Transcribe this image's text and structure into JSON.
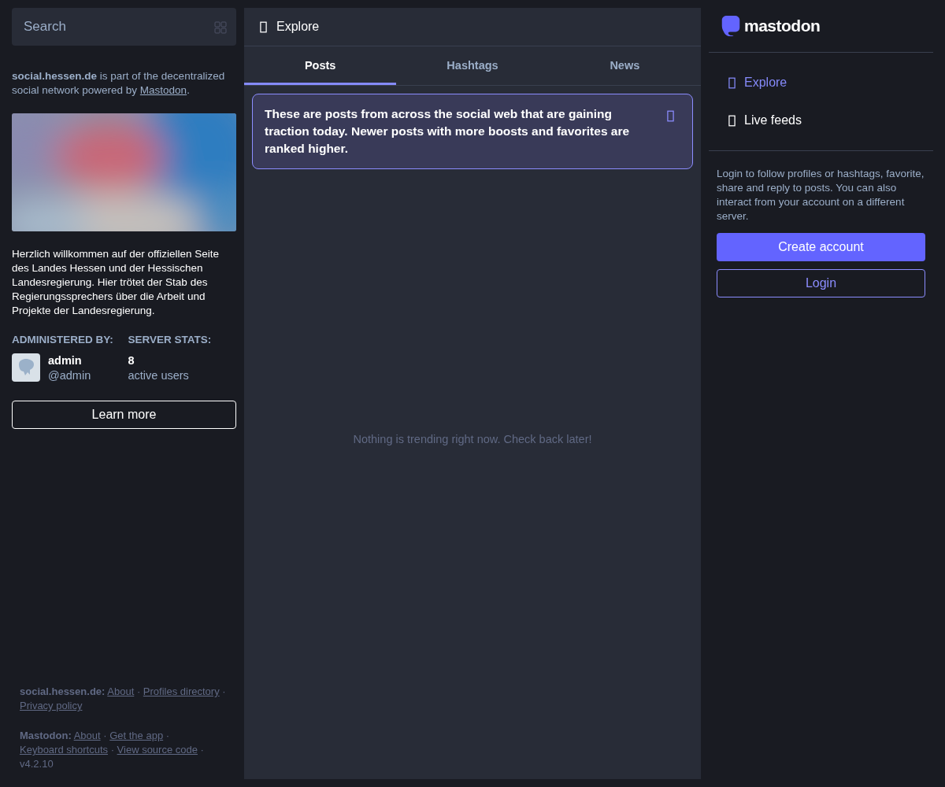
{
  "search": {
    "placeholder": "Search"
  },
  "intro": {
    "domain": "social.hessen.de",
    "text": " is part of the decentralized social network powered by ",
    "link": "Mastodon",
    "after": "."
  },
  "description": "Herzlich willkommen auf der offiziellen Seite des Landes Hessen und der Hessischen Landesregierung. Hier trötet der Stab des Regierungssprechers über die Arbeit und Projekte der Landesregierung.",
  "admin": {
    "heading": "ADMINISTERED BY:",
    "name": "admin",
    "handle": "@admin"
  },
  "stats": {
    "heading": "SERVER STATS:",
    "count": "8",
    "label": "active users"
  },
  "learn_more": "Learn more",
  "footer": [
    {
      "label": "social.hessen.de:",
      "separator": "·",
      "links": [
        "About",
        "Profiles directory",
        "Privacy policy"
      ]
    },
    {
      "label": "Mastodon:",
      "separator": "·",
      "links": [
        "About",
        "Get the app",
        "Keyboard shortcuts",
        "View source code"
      ],
      "version": "v4.2.10"
    }
  ],
  "column": {
    "title": "Explore"
  },
  "tabs": [
    {
      "label": "Posts",
      "selected": true
    },
    {
      "label": "Hashtags",
      "selected": false
    },
    {
      "label": "News",
      "selected": false
    }
  ],
  "notice": "These are posts from across the social web that are gaining traction today. Newer posts with more boosts and favorites are ranked higher.",
  "empty_message": "Nothing is trending right now. Check back later!",
  "logo": "mastodon",
  "nav": [
    {
      "label": "Explore",
      "selected": true
    },
    {
      "label": "Live feeds",
      "selected": false
    }
  ],
  "login_hint": "Login to follow profiles or hashtags, favorite, share and reply to posts. You can also interact from your account on a different server.",
  "buttons": [
    {
      "kind": "primary",
      "label": "Create account"
    },
    {
      "kind": "outline",
      "label": "Login"
    }
  ]
}
